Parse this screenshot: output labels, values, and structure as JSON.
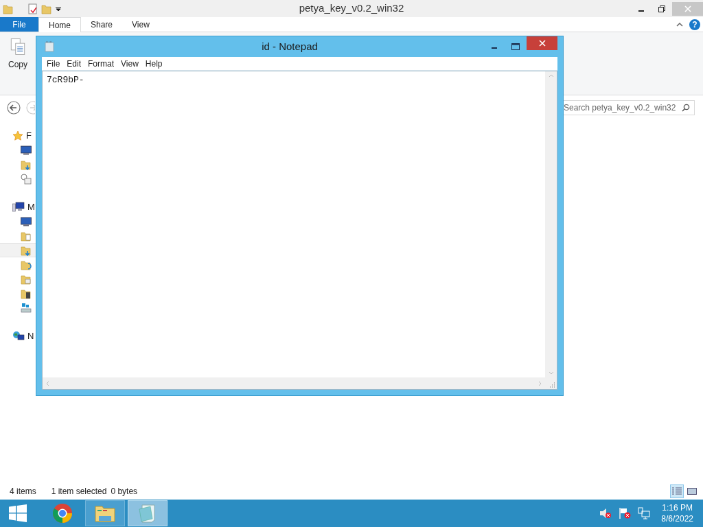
{
  "explorer": {
    "title": "petya_key_v0.2_win32",
    "ribbon_tabs": [
      {
        "label": "File",
        "kind": "file",
        "selected": false
      },
      {
        "label": "Home",
        "kind": "tab",
        "selected": true
      },
      {
        "label": "Share",
        "kind": "tab",
        "selected": false
      },
      {
        "label": "View",
        "kind": "tab",
        "selected": false
      }
    ],
    "help_label": "?",
    "copy_label": "Copy",
    "search": {
      "placeholder": "Search petya_key_v0.2_win32"
    },
    "nav_sections": [
      {
        "label": "F",
        "kind": "favorites",
        "items": [
          {
            "kind": "desktop",
            "selected": false
          },
          {
            "kind": "downloads",
            "selected": false
          },
          {
            "kind": "recent",
            "selected": false
          }
        ]
      },
      {
        "label": "M",
        "kind": "computer",
        "items": [
          {
            "kind": "desktop",
            "selected": false
          },
          {
            "kind": "documents",
            "selected": false
          },
          {
            "kind": "downloads",
            "selected": true
          },
          {
            "kind": "music",
            "selected": false
          },
          {
            "kind": "pictures",
            "selected": false
          },
          {
            "kind": "videos",
            "selected": false
          },
          {
            "kind": "drive",
            "selected": false
          }
        ]
      },
      {
        "label": "N",
        "kind": "network"
      }
    ],
    "status": [
      "4 items",
      "1 item selected",
      "0 bytes"
    ],
    "view_buttons": [
      {
        "kind": "details",
        "selected": true
      },
      {
        "kind": "large",
        "selected": false
      }
    ]
  },
  "notepad": {
    "title": "id - Notepad",
    "menu": [
      "File",
      "Edit",
      "Format",
      "View",
      "Help"
    ],
    "text": "7cR9bP-"
  },
  "taskbar": {
    "apps": [
      {
        "kind": "chrome",
        "selected": false
      },
      {
        "kind": "explorer",
        "selected": false
      },
      {
        "kind": "notepad",
        "selected": true
      }
    ],
    "time": "1:16 PM",
    "date": "8/6/2022"
  }
}
